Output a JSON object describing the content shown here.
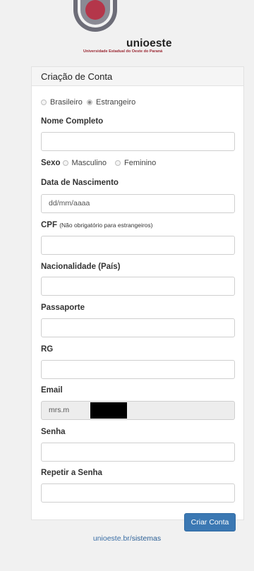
{
  "logo": {
    "name": "unioeste",
    "subtitle": "Universidade Estadual do Oeste do Paraná"
  },
  "form": {
    "title": "Criação de Conta",
    "nationality_options": [
      {
        "label": "Brasileiro",
        "checked": false
      },
      {
        "label": "Estrangeiro",
        "checked": true
      }
    ],
    "nome_completo": {
      "label": "Nome Completo",
      "value": ""
    },
    "sexo": {
      "label": "Sexo",
      "options": [
        {
          "label": "Masculino",
          "checked": false
        },
        {
          "label": "Feminino",
          "checked": false
        }
      ]
    },
    "data_nascimento": {
      "label": "Data de Nascimento",
      "placeholder": "dd/mm/aaaa"
    },
    "cpf": {
      "label": "CPF",
      "note": "(Não obrigatório para estrangeiros)",
      "value": ""
    },
    "nacionalidade": {
      "label": "Nacionalidade (País)",
      "value": ""
    },
    "passaporte": {
      "label": "Passaporte",
      "value": ""
    },
    "rg": {
      "label": "RG",
      "value": ""
    },
    "email": {
      "label": "Email",
      "value": "mrs.m"
    },
    "senha": {
      "label": "Senha",
      "value": ""
    },
    "repetir_senha": {
      "label": "Repetir a Senha",
      "value": ""
    },
    "submit_label": "Criar Conta"
  },
  "footer": {
    "prefix": "unioeste.br/",
    "link": "sistemas"
  },
  "colors": {
    "brand_red": "#b4364a",
    "logo_gray": "#6d6d78",
    "button_blue": "#3b78b3",
    "link_blue": "#3a6ea5"
  }
}
